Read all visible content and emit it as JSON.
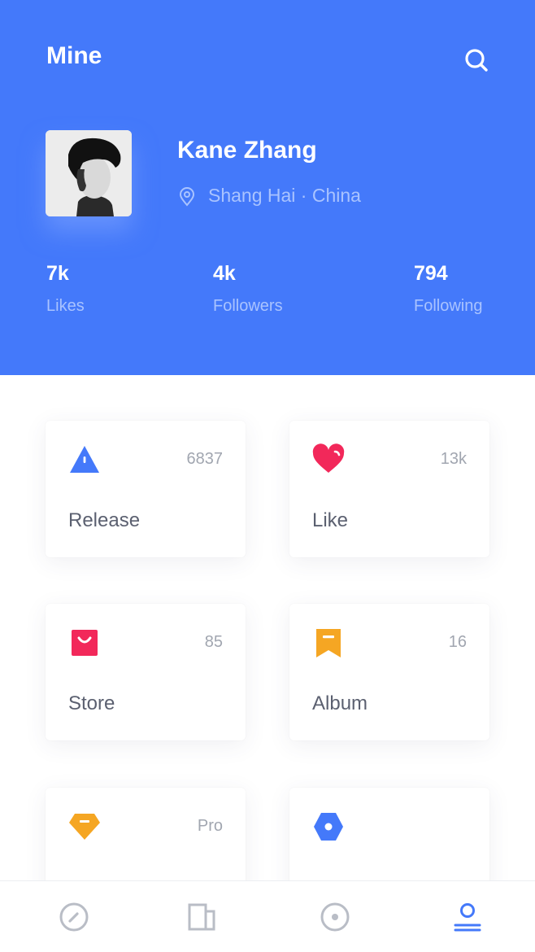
{
  "header": {
    "title": "Mine",
    "background": "#4479fa"
  },
  "profile": {
    "name": "Kane Zhang",
    "location": "Shang Hai · China"
  },
  "stats": [
    {
      "value": "7k",
      "label": "Likes"
    },
    {
      "value": "4k",
      "label": "Followers"
    },
    {
      "value": "794",
      "label": "Following"
    }
  ],
  "cards": [
    {
      "icon": "release-icon",
      "count": "6837",
      "label": "Release",
      "color": "#4479fa"
    },
    {
      "icon": "heart-icon",
      "count": "13k",
      "label": "Like",
      "color": "#f2285a"
    },
    {
      "icon": "store-bag-icon",
      "count": "85",
      "label": "Store",
      "color": "#f2285a"
    },
    {
      "icon": "bookmark-icon",
      "count": "16",
      "label": "Album",
      "color": "#f5a623"
    },
    {
      "icon": "diamond-icon",
      "count": "Pro",
      "label": "",
      "color": "#f5a623"
    },
    {
      "icon": "hexagon-icon",
      "count": "",
      "label": "",
      "color": "#4479fa"
    }
  ],
  "tabbar": {
    "items": [
      "compass-icon",
      "book-icon",
      "disc-icon",
      "user-icon"
    ],
    "active_index": 3,
    "inactive_color": "#b9bdc6",
    "active_color": "#4479fa"
  }
}
